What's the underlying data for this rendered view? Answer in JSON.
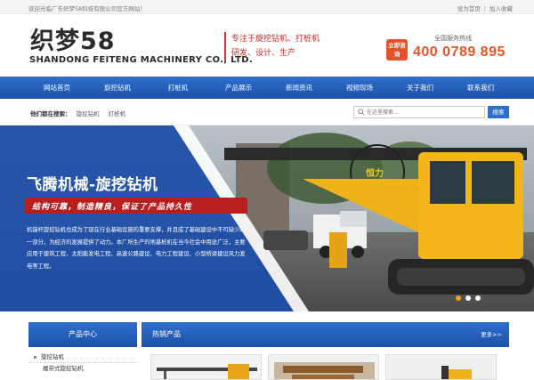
{
  "topbar": {
    "welcome": "欢迎光临广东织梦58科技有限公司官方网站！",
    "links": [
      "设为首页",
      "加入收藏"
    ]
  },
  "header": {
    "logo_text": "织梦58",
    "company_en": "SHANDONG FEITENG MACHINERY CO., LTD.",
    "slogan_line1": "专注于旋挖钻机、打桩机",
    "slogan_line2": "研发、设计、生产",
    "hotline_badge": "立即咨询",
    "hotline_label": "全国服务热线",
    "hotline_number": "400 0789 895"
  },
  "nav": {
    "items": [
      "网站首页",
      "旋挖钻机",
      "打桩机",
      "产品展示",
      "新闻资讯",
      "视频现场",
      "关于我们",
      "联系我们"
    ]
  },
  "search": {
    "hot_label": "他们都在搜索：",
    "keywords": [
      "旋挖钻机",
      "打桩机"
    ],
    "placeholder": "在这里搜索...",
    "button": "搜索"
  },
  "banner": {
    "title": "飞腾机械-旋挖钻机",
    "tagline": "结构可靠，制造精良，保证了产品持久性",
    "description": "机锚杆旋挖钻机也成为了现在行业基础设施的重要支撑，并且成了基础建设中不可缺少的一部分，为经济的发展提供了动力。本厂所生产的地基桩机在当今社会中用途广泛，主要应用于建筑工程、太阳能发电工程、高速公路建设、电力工程建设、小型桥梁建设风力发电等工程。",
    "machine_brand": "恒力",
    "slides": 3,
    "active_slide": 1
  },
  "sidebar": {
    "heading": "产品中心",
    "items": [
      {
        "label": "旋挖钻机",
        "level": 1
      },
      {
        "label": "履带式旋挖钻机",
        "level": 2
      }
    ]
  },
  "hot_products": {
    "heading": "热销产品",
    "more": "更多>>"
  },
  "colors": {
    "nav_blue": "#2f6fcd",
    "accent_orange": "#e5532b",
    "slogan_red": "#c62828"
  }
}
